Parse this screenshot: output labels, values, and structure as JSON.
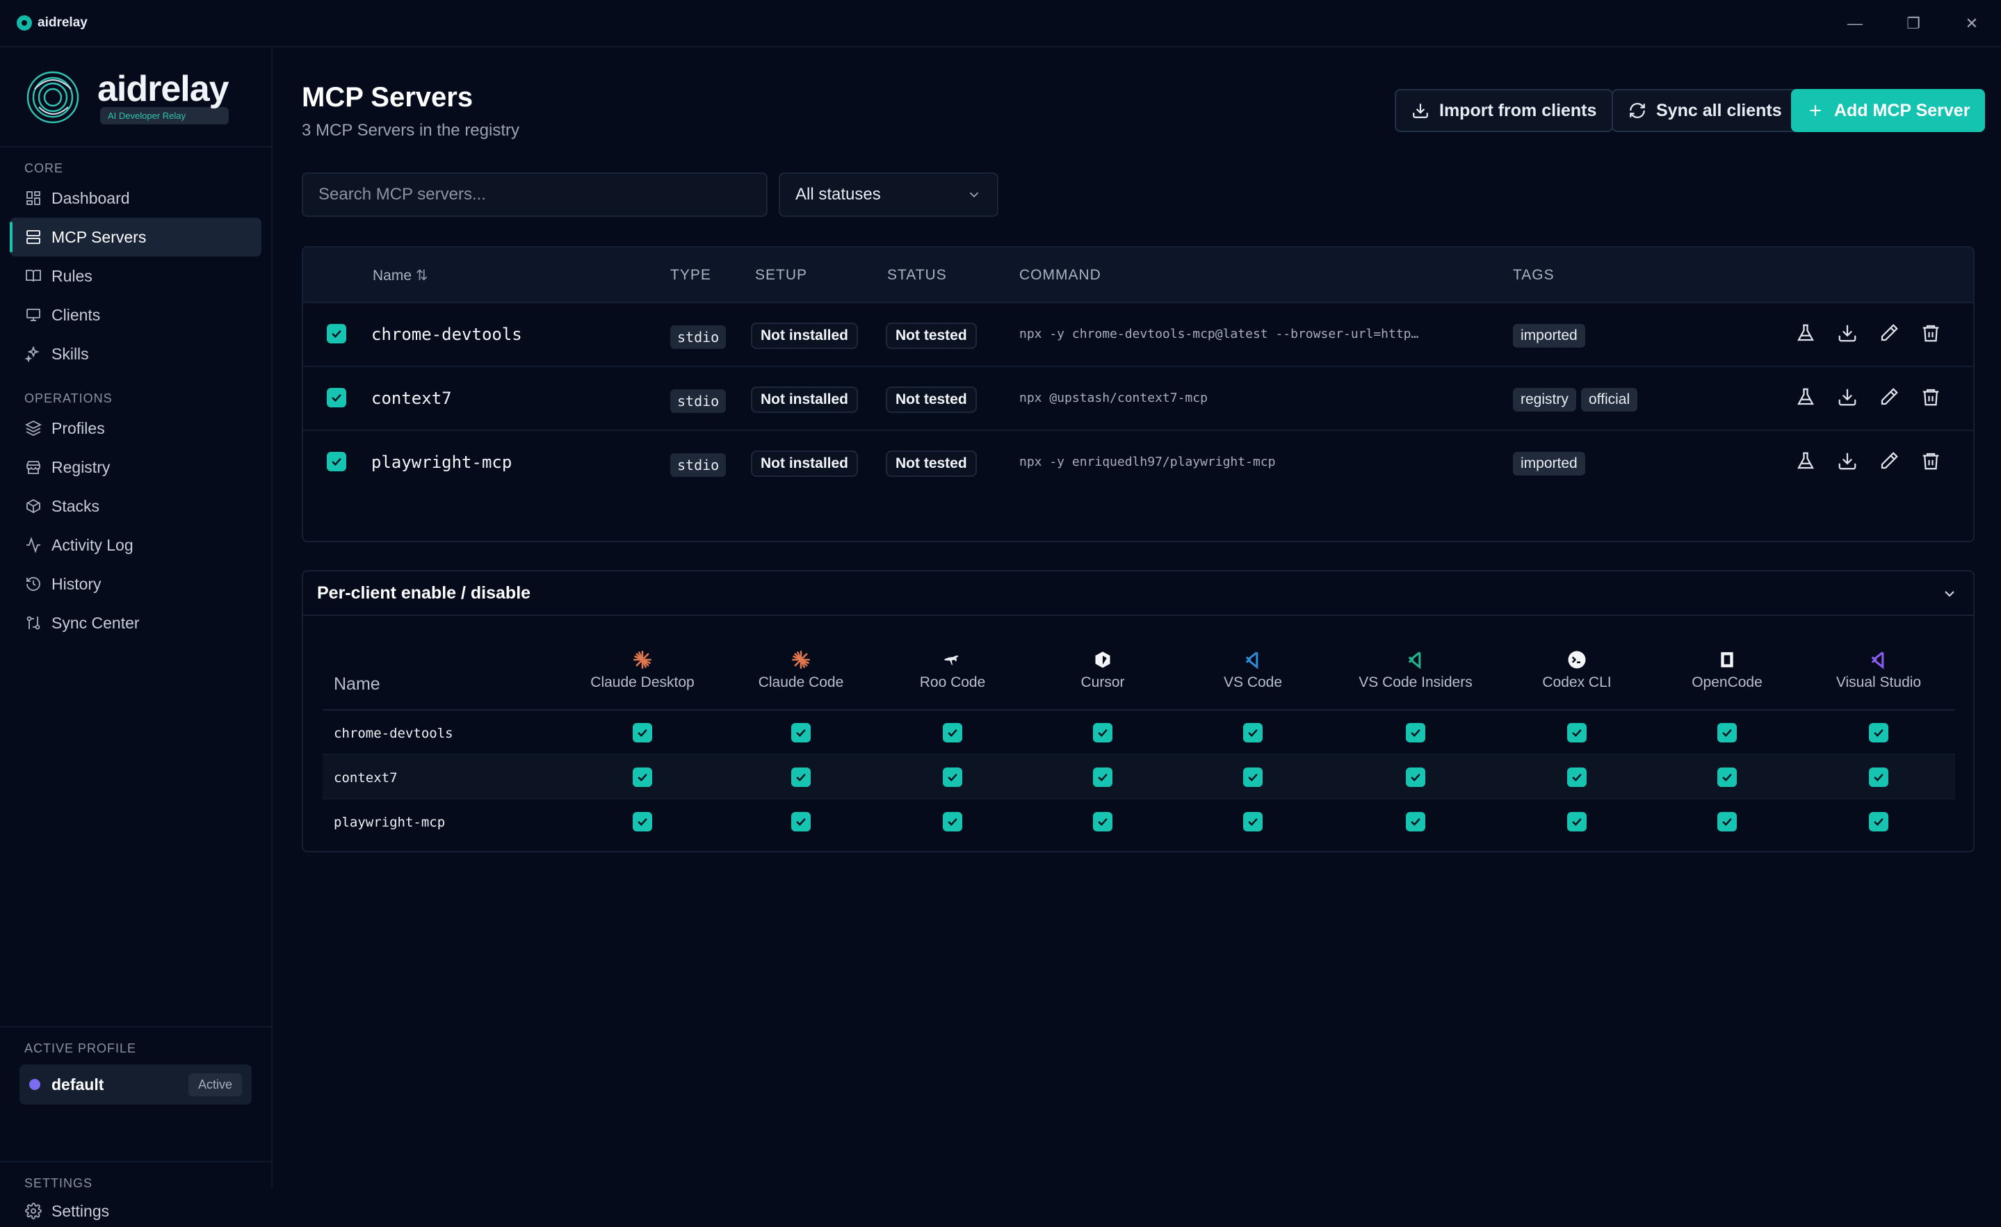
{
  "titlebar": {
    "app_name": "aidrelay",
    "controls": [
      "minimize",
      "restore",
      "close"
    ]
  },
  "brand": {
    "name": "aidrelay",
    "tagline": "AI Developer Relay"
  },
  "sidebar": {
    "core_label": "CORE",
    "core_items": [
      {
        "label": "Dashboard",
        "icon": "dashboard-icon"
      },
      {
        "label": "MCP Servers",
        "icon": "server-icon",
        "active": true
      },
      {
        "label": "Rules",
        "icon": "book-icon"
      },
      {
        "label": "Clients",
        "icon": "monitor-icon"
      },
      {
        "label": "Skills",
        "icon": "sparkles-icon"
      }
    ],
    "ops_label": "OPERATIONS",
    "ops_items": [
      {
        "label": "Profiles",
        "icon": "layers-icon"
      },
      {
        "label": "Registry",
        "icon": "store-icon"
      },
      {
        "label": "Stacks",
        "icon": "package-icon"
      },
      {
        "label": "Activity Log",
        "icon": "activity-icon"
      },
      {
        "label": "History",
        "icon": "history-icon"
      },
      {
        "label": "Sync Center",
        "icon": "git-compare-icon"
      }
    ],
    "active_profile_label": "ACTIVE PROFILE",
    "profile": {
      "name": "default",
      "badge": "Active",
      "color": "#7c6cf0"
    },
    "settings_label": "SETTINGS",
    "settings_item": "Settings"
  },
  "header": {
    "title": "MCP Servers",
    "subtitle": "3 MCP Servers in the registry",
    "import_label": "Import from clients",
    "sync_label": "Sync all clients",
    "add_label": "Add MCP Server"
  },
  "filters": {
    "search_placeholder": "Search MCP servers...",
    "status_selected": "All statuses"
  },
  "table": {
    "columns": {
      "name": "Name",
      "type": "TYPE",
      "setup": "SETUP",
      "status": "STATUS",
      "command": "COMMAND",
      "tags": "TAGS"
    },
    "rows": [
      {
        "name": "chrome-devtools",
        "type": "stdio",
        "setup": "Not installed",
        "status": "Not tested",
        "command": "npx -y chrome-devtools-mcp@latest --browser-url=http…",
        "tags": [
          "imported"
        ]
      },
      {
        "name": "context7",
        "type": "stdio",
        "setup": "Not installed",
        "status": "Not tested",
        "command": "npx @upstash/context7-mcp",
        "tags": [
          "registry",
          "official"
        ]
      },
      {
        "name": "playwright-mcp",
        "type": "stdio",
        "setup": "Not installed",
        "status": "Not tested",
        "command": "npx -y enriquedlh97/playwright-mcp",
        "tags": [
          "imported"
        ]
      }
    ]
  },
  "per_client": {
    "title": "Per-client enable / disable",
    "name_header": "Name",
    "clients": [
      {
        "label": "Claude Desktop",
        "icon": "claude-icon"
      },
      {
        "label": "Claude Code",
        "icon": "claude-icon"
      },
      {
        "label": "Roo Code",
        "icon": "kangaroo-icon"
      },
      {
        "label": "Cursor",
        "icon": "cursor-icon"
      },
      {
        "label": "VS Code",
        "icon": "vscode-icon"
      },
      {
        "label": "VS Code Insiders",
        "icon": "vscode-insiders-icon"
      },
      {
        "label": "Codex CLI",
        "icon": "codex-icon"
      },
      {
        "label": "OpenCode",
        "icon": "opencode-icon"
      },
      {
        "label": "Visual Studio",
        "icon": "visual-studio-icon"
      }
    ],
    "rows": [
      "chrome-devtools",
      "context7",
      "playwright-mcp"
    ]
  },
  "colors": {
    "accent": "#14c3b0",
    "background": "#050b1a",
    "claude": "#e0764e",
    "vscode": "#2f8bd6",
    "vscode_insiders": "#22b58f",
    "visual_studio": "#8b5cf6"
  }
}
